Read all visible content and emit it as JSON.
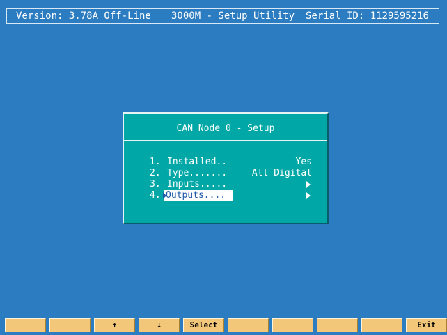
{
  "header": {
    "version": "Version: 3.78A Off-Line",
    "title": "3000M - Setup Utility",
    "serial": "Serial ID: 1129595216"
  },
  "dialog": {
    "title": "CAN Node 0 - Setup",
    "items": [
      {
        "num": "1.",
        "label": "Installed..",
        "value": "Yes"
      },
      {
        "num": "2.",
        "label": "Type.......",
        "value": "All Digital"
      },
      {
        "num": "3.",
        "label": "Inputs.....",
        "icon": "submenu-arrow-icon"
      },
      {
        "num": "4.",
        "label": "Outputs....",
        "icon": "submenu-arrow-icon",
        "selected": true
      }
    ]
  },
  "fkeys": [
    "",
    "",
    "↑",
    "↓",
    "Select",
    "",
    "",
    "",
    "",
    "Exit"
  ],
  "colors": {
    "background": "#2b7cc1",
    "dialog": "#00a7a7",
    "fkey": "#f2c77a",
    "highlight_text": "#1e5ba8"
  }
}
